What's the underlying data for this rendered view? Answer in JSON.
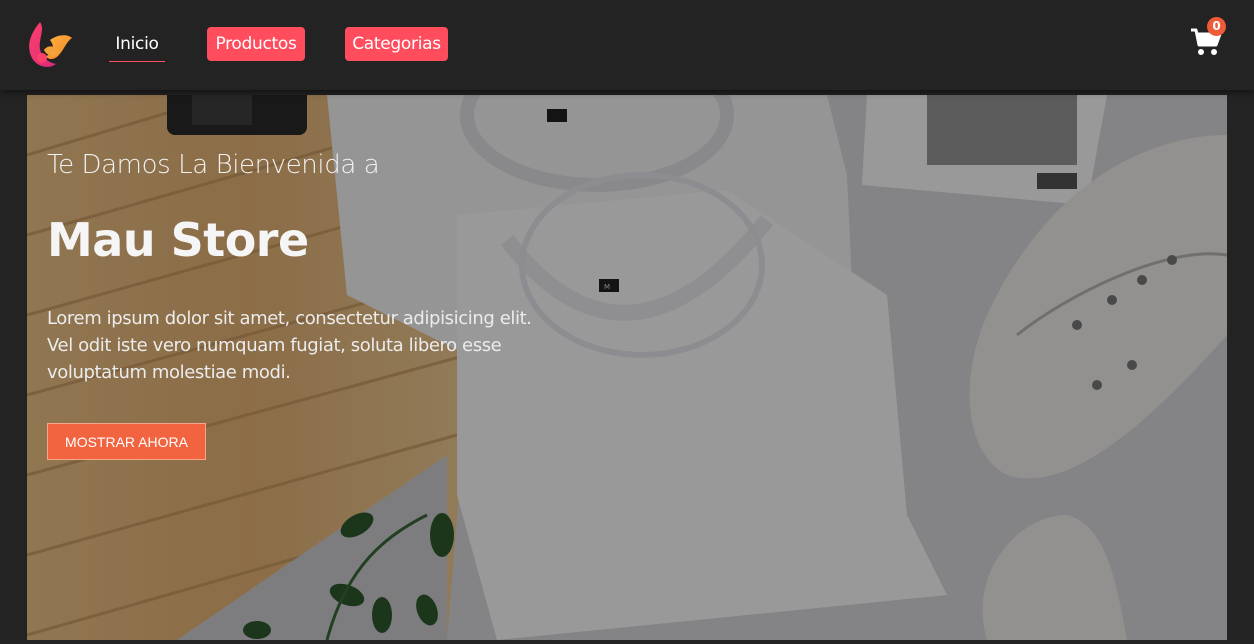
{
  "nav": {
    "links": [
      {
        "label": "Inicio"
      },
      {
        "label": "Productos"
      },
      {
        "label": "Categorias"
      }
    ],
    "cart_count": "0"
  },
  "hero": {
    "welcome": "Te Damos La Bienvenida a",
    "title": "Mau Store",
    "description": "Lorem ipsum dolor sit amet, consectetur adipisicing elit. Vel odit iste vero numquam fugiat, soluta libero esse voluptatum molestiae modi.",
    "cta_label": "MOSTRAR AHORA",
    "shirt_size_label": "M"
  },
  "colors": {
    "background": "#232323",
    "accent_pink": "#ff4d5e",
    "cta_orange": "#f26440",
    "badge": "#ef5a39"
  }
}
